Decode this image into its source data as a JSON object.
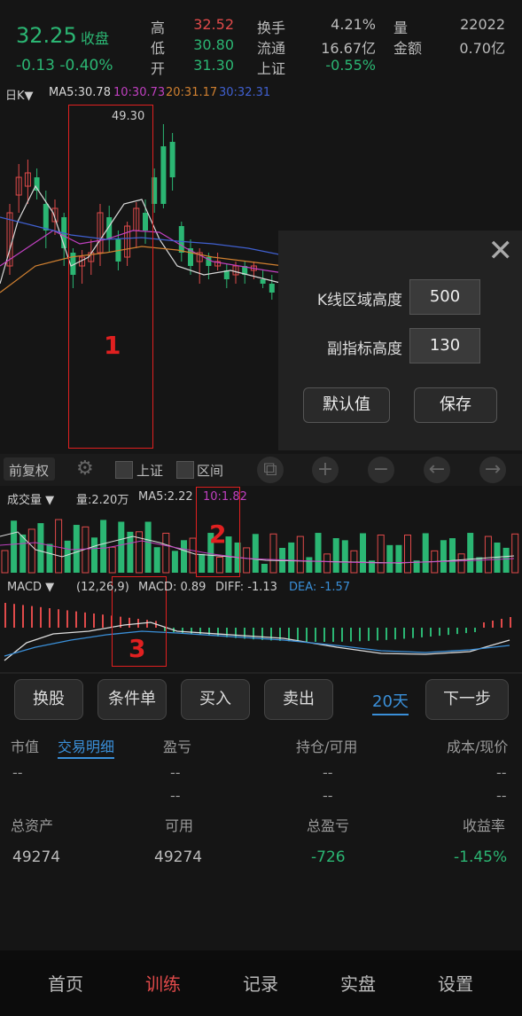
{
  "header": {
    "price": "32.25",
    "price_status": "收盘",
    "change": "-0.13  -0.40%",
    "stats": [
      {
        "label": "高",
        "value": "32.52",
        "color": "#e04a4a"
      },
      {
        "label": "低",
        "value": "30.80",
        "color": "#2bb673"
      },
      {
        "label": "开",
        "value": "31.30",
        "color": "#2bb673"
      }
    ],
    "stats2": [
      {
        "label": "换手",
        "value": "4.21%",
        "color": "#bbbbbb"
      },
      {
        "label": "流通",
        "value": "16.67亿",
        "color": "#bbbbbb"
      },
      {
        "label": "上证",
        "value": "-0.55%",
        "color": "#2bb673"
      }
    ],
    "stats3": [
      {
        "label": "量",
        "value": "22022",
        "color": "#bbbbbb"
      },
      {
        "label": "金额",
        "value": "0.70亿",
        "color": "#bbbbbb"
      }
    ]
  },
  "kline": {
    "period": "日K▼",
    "ma5": "MA5:30.78",
    "ma10": "10:30.73",
    "ma20": "20:31.17",
    "ma30": "30:32.31",
    "peak_label": "49.30",
    "colors": {
      "ma5": "#d8d8d8",
      "ma10": "#c040c0",
      "ma20": "#d08030",
      "ma30": "#4060d0",
      "up": "#e04a4a",
      "down": "#2bb673"
    }
  },
  "settings_panel": {
    "kline_height_label": "K线区域高度",
    "kline_height_value": "500",
    "sub_height_label": "副指标高度",
    "sub_height_value": "130",
    "default_btn": "默认值",
    "save_btn": "保存"
  },
  "toolbar": {
    "adjust": "前复权",
    "shanghai": "上证",
    "interval": "区间"
  },
  "volume": {
    "title": "成交量 ▼",
    "vol": "量:2.20万",
    "ma5": "MA5:2.22",
    "ma10": "10:1.82"
  },
  "macd": {
    "title": "MACD ▼",
    "params": "(12,26,9)",
    "macd": "MACD: 0.89",
    "diff": "DIFF: -1.13",
    "dea": "DEA: -1.57"
  },
  "annotations": [
    "1",
    "2",
    "3"
  ],
  "actions": {
    "change_stock": "换股",
    "conditional": "条件单",
    "buy": "买入",
    "sell": "卖出",
    "days": "20天",
    "next": "下一步"
  },
  "position_table": {
    "headers": [
      "市值",
      "交易明细",
      "盈亏",
      "持仓/可用",
      "成本/现价"
    ],
    "row1": [
      "--",
      "--",
      "--",
      "--"
    ],
    "row2": [
      "--",
      "--",
      "--"
    ]
  },
  "summary": {
    "headers": [
      "总资产",
      "可用",
      "总盈亏",
      "收益率"
    ],
    "values": [
      "49274",
      "49274",
      "-726",
      "-1.45%"
    ]
  },
  "nav": [
    "首页",
    "训练",
    "记录",
    "实盘",
    "设置"
  ],
  "chart_data": {
    "type": "candlestick",
    "peak": 49.3,
    "ma": {
      "MA5": 30.78,
      "MA10": 30.73,
      "MA20": 31.17,
      "MA30": 32.31
    }
  }
}
